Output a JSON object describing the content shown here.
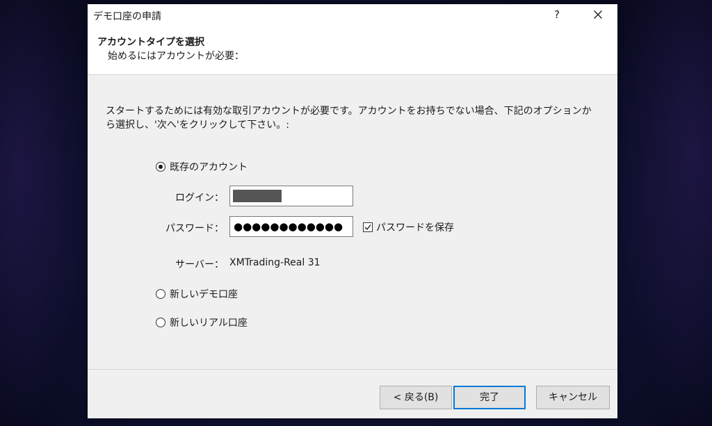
{
  "window": {
    "title": "デモ口座の申請",
    "help_label": "?"
  },
  "header": {
    "title": "アカウントタイプを選択",
    "subtitle": "始めるにはアカウントが必要："
  },
  "description": "スタートするためには有効な取引アカウントが必要です。アカウントをお持ちでない場合、下記のオプションから選択し、'次へ'をクリックして下さい。:",
  "options": {
    "existing": {
      "label": "既存のアカウント",
      "checked": true
    },
    "new_demo": {
      "label": "新しいデモ口座",
      "checked": false
    },
    "new_real": {
      "label": "新しいリアル口座",
      "checked": false
    }
  },
  "form": {
    "login_label": "ログイン：",
    "password_label": "パスワード：",
    "password_value": "●●●●●●●●●●●●",
    "save_password_label": "パスワードを保存",
    "save_password_checked": true,
    "server_label": "サーバー：",
    "server_value": "XMTrading-Real 31"
  },
  "buttons": {
    "back": "< 戻る(B)",
    "finish": "完了",
    "cancel": "キャンセル"
  }
}
